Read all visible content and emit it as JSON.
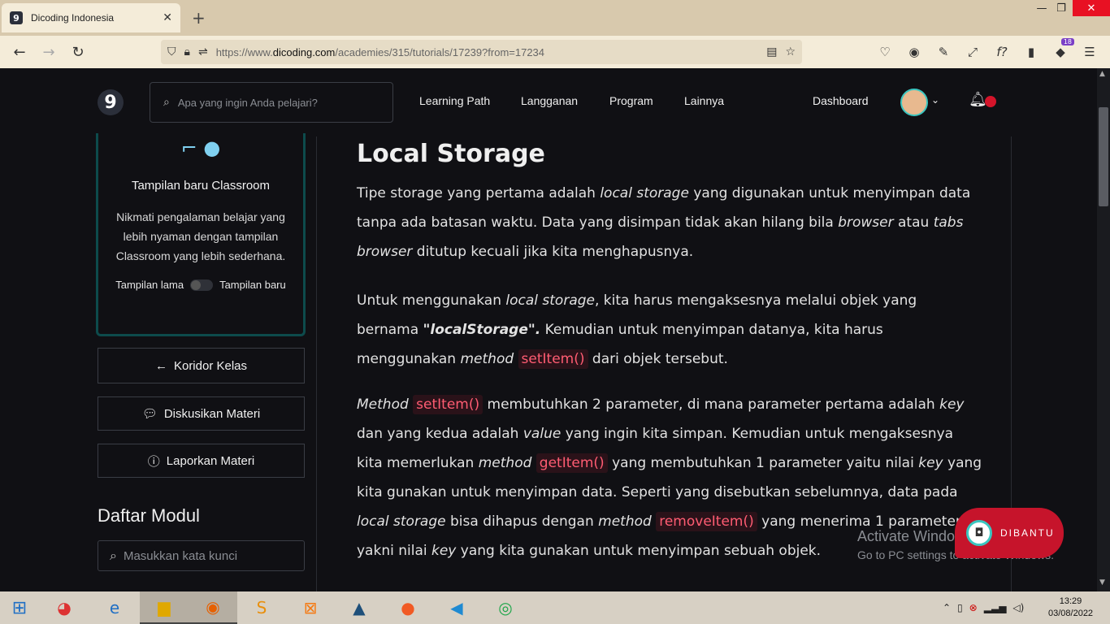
{
  "browser": {
    "tab_title": "Dicoding Indonesia",
    "url_prefix": "https://www.",
    "url_domain": "dicoding.com",
    "url_path": "/academies/315/tutorials/17239?from=17234",
    "extension_badge": "18"
  },
  "header": {
    "logo": "9",
    "search_placeholder": "Apa yang ingin Anda pelajari?",
    "menu": [
      "Learning Path",
      "Langganan",
      "Program",
      "Lainnya",
      "Dashboard"
    ]
  },
  "sidebar": {
    "promo_title": "Tampilan baru Classroom",
    "promo_desc": "Nikmati pengalaman belajar yang lebih nyaman dengan tampilan Classroom yang lebih sederhana.",
    "toggle_left": "Tampilan lama",
    "toggle_right": "Tampilan baru",
    "btn_koridor": "Koridor Kelas",
    "btn_diskusi": "Diskusikan Materi",
    "btn_lapor": "Laporkan Materi",
    "modul_title": "Daftar Modul",
    "modul_placeholder": "Masukkan kata kunci"
  },
  "content": {
    "title": "Local Storage",
    "p1": {
      "a": "Tipe storage yang pertama adalah ",
      "b": "local storage",
      "c": " yang digunakan untuk menyimpan data tanpa ada batasan waktu. Data yang disimpan tidak akan hilang bila ",
      "d": "browser",
      "e": " atau ",
      "f": "tabs browser",
      "g": " ditutup kecuali jika kita menghapusnya."
    },
    "p2": {
      "a": "Untuk menggunakan ",
      "b": "local storage",
      "c": ", kita harus mengaksesnya melalui objek yang bernama ",
      "d": "\"localStorage\".",
      "e": " Kemudian untuk menyimpan datanya, kita harus menggunakan ",
      "f": "method",
      "code": "setItem()",
      "g": " dari objek tersebut."
    },
    "p3": {
      "a": "Method",
      "code1": "setItem()",
      "b": " membutuhkan 2 parameter, di mana parameter pertama adalah ",
      "c": "key",
      "d": " dan yang kedua adalah ",
      "e": "value",
      "f": " yang ingin kita simpan. Kemudian untuk mengaksesnya kita memerlukan ",
      "g": "method",
      "code2": "getItem()",
      "h": " yang membutuhkan 1 parameter yaitu nilai ",
      "i": "key",
      "j": " yang kita gunakan untuk menyimpan data. Seperti yang disebutkan sebelumnya, data pada ",
      "k": "local storage",
      "l": " bisa dihapus dengan ",
      "m": "method",
      "code3": "removeItem()",
      "n": " yang menerima 1 parameter yakni nilai ",
      "o": "key",
      "p": " yang kita gunakan untuk menyimpan sebuah objek."
    }
  },
  "overlay": {
    "activate_title": "Activate Windows",
    "activate_sub": "Go to PC settings to activate Windows.",
    "dibantu": "DIBANTU"
  },
  "taskbar": {
    "time": "13:29",
    "date": "03/08/2022"
  }
}
